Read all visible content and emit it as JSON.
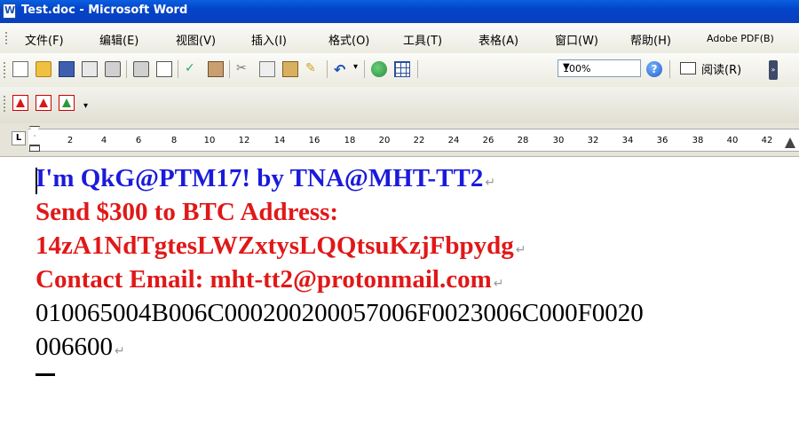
{
  "window": {
    "title": "Test.doc - Microsoft Word"
  },
  "menu": [
    "文件(F)",
    "编辑(E)",
    "视图(V)",
    "插入(I)",
    "格式(O)",
    "工具(T)",
    "表格(A)",
    "窗口(W)",
    "帮助(H)",
    "Adobe PDF(B)"
  ],
  "toolbar": {
    "zoom": "100%",
    "read_label": "阅读(R)",
    "icons": [
      "new-icon",
      "open-icon",
      "save-icon",
      "permission-icon",
      "print-icon",
      "print-preview-icon",
      "spelling-icon",
      "research-icon",
      "cut-icon",
      "copy-icon",
      "paste-icon",
      "format-painter-icon",
      "undo-icon",
      "hyperlink-icon",
      "table-icon",
      "help-icon",
      "read-icon"
    ]
  },
  "pdf_toolbar": {
    "icons": [
      "convert-to-pdf-icon",
      "convert-and-email-icon",
      "convert-and-review-icon"
    ]
  },
  "ruler": {
    "numbers": [
      "2",
      "4",
      "6",
      "8",
      "10",
      "12",
      "14",
      "16",
      "18",
      "20",
      "22",
      "24",
      "26",
      "28",
      "30",
      "32",
      "34",
      "36",
      "38",
      "40",
      "42"
    ]
  },
  "document": {
    "lines": [
      "I'm QkG@PTM17! by TNA@MHT-TT2",
      "Send $300 to BTC Address:",
      "14zA1NdTgtesLWZxtysLQQtsuKzjFbpydg",
      "Contact Email: mht-tt2@protonmail.com",
      "010065004B006C000200200057006F0023006C000F0020",
      "006600"
    ],
    "paragraph_mark": "↵",
    "colors": {
      "blue": "#1a1adc",
      "red": "#e01818",
      "black": "#000000"
    }
  }
}
